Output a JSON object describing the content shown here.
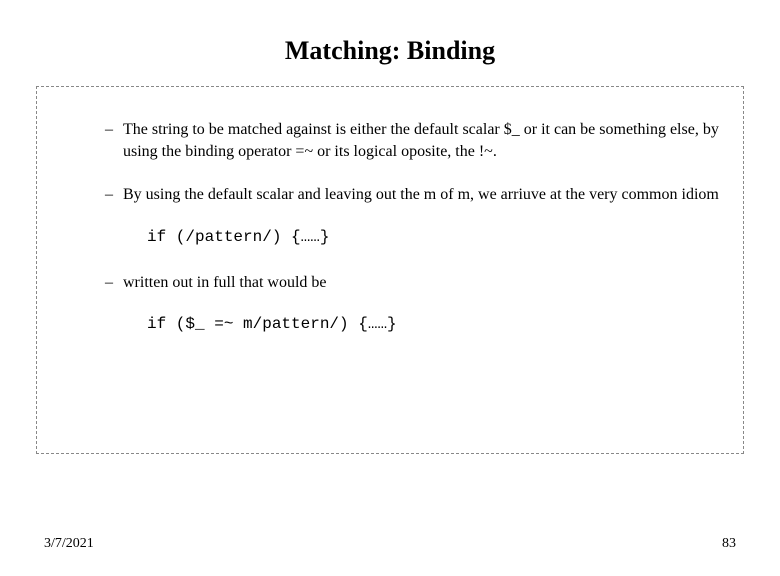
{
  "title": "Matching: Binding",
  "bullets": [
    "The string to be matched against is either the default scalar $_ or it can be something else, by using the binding operator =~ or its logical oposite, the !~.",
    "By using the default scalar and leaving out the m of m, we arriuve at the very common idiom",
    "written out in full that would be"
  ],
  "code": {
    "line1": "if (/pattern/) {……}",
    "line2": "if ($_ =~ m/pattern/) {……}"
  },
  "footer": {
    "date": "3/7/2021",
    "page": "83"
  }
}
